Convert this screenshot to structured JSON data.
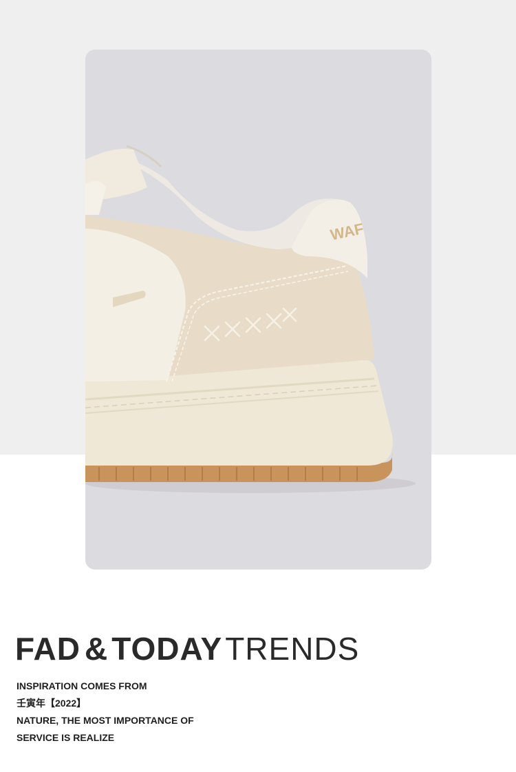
{
  "colors": {
    "top_band": "#efefef",
    "photo_background": "#dcdbe0",
    "sneaker_upper": "#f3efe4",
    "sneaker_suede": "#e8dcc8",
    "sole": "#efe8d6",
    "gum_outsole": "#c9935c",
    "heading_text": "#2a2a2a"
  },
  "photo": {
    "heel_tab_lettering": "WAF",
    "icon": "sneaker-heel-closeup-image"
  },
  "headline": {
    "word1": "FAD",
    "amp": "&",
    "word2": "TODAY",
    "word3": "TRENDS"
  },
  "description": {
    "line1": "INSPIRATION COMES FROM",
    "line2": "壬寅年【2022】",
    "line3": "NATURE, THE MOST IMPORTANCE OF",
    "line4": "SERVICE IS REALIZE"
  }
}
